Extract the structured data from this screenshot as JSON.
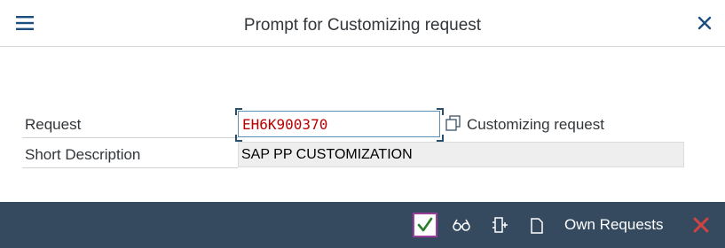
{
  "dialog": {
    "title": "Prompt for Customizing request"
  },
  "form": {
    "request_label": "Request",
    "request_value": "EH6K900370",
    "request_type": "Customizing request",
    "short_description_label": "Short Description",
    "short_description_value": "SAP PP CUSTOMIZATION"
  },
  "footer": {
    "own_requests_label": "Own Requests",
    "icons": [
      "confirm-icon",
      "display-icon",
      "create-icon",
      "copy-icon",
      "cancel-icon"
    ]
  },
  "colors": {
    "footer_bg": "#354a5f",
    "accent": "#1c4e80",
    "request_text": "#bb0000",
    "confirm_green": "#2b7d2b",
    "cancel_red": "#d04343"
  }
}
